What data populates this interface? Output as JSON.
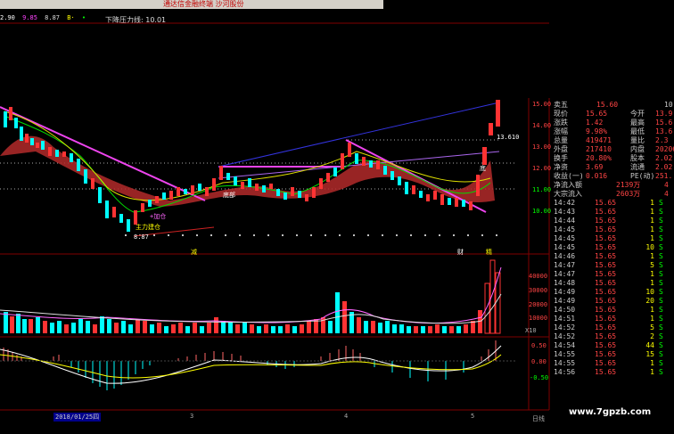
{
  "window": {
    "title": "通达信金融终端 沙河股份"
  },
  "legend": [
    {
      "label": "2.90",
      "color": "#ffffff"
    },
    {
      "label": "9.85",
      "color": "#ff44ff"
    },
    {
      "label": "8.87",
      "color": "#dddddd"
    },
    {
      "label": "B·",
      "color": "#ffff00"
    },
    {
      "label": "•",
      "color": "#00ff00"
    }
  ],
  "chart_title": "下降压力线: 10.01",
  "price_axis": [
    "15.00",
    "14.00",
    "13.00",
    "12.00",
    "11.00",
    "10.00"
  ],
  "price_marker": "13.610",
  "volume_axis": [
    "40000",
    "30000",
    "20000",
    "10000"
  ],
  "volume_unit": "X10",
  "macd_axis": [
    "0.50",
    "0.00",
    "-0.50"
  ],
  "annotations": {
    "a1": "主力建仓",
    "a2": "+加仓",
    "a3": "8.87",
    "a4": "减",
    "a5": "财",
    "a6": "精",
    "a7": "底",
    "a8": "底部"
  },
  "x_axis": {
    "date": "2018/01/25四",
    "ticks": [
      "3",
      "4",
      "5"
    ]
  },
  "corner_label": "日线",
  "watermark": "www.7gpzb.com",
  "quote": {
    "sell5": {
      "label": "卖五",
      "price": "15.60",
      "vol": "10"
    },
    "rows": [
      {
        "l1": "现价",
        "v1": "15.65",
        "l2": "今开",
        "v2": "13.9"
      },
      {
        "l1": "涨跌",
        "v1": "1.42",
        "l2": "最高",
        "v2": "15.6"
      },
      {
        "l1": "涨幅",
        "v1": "9.98%",
        "l2": "最低",
        "v2": "13.6"
      },
      {
        "l1": "总量",
        "v1": "419471",
        "l2": "量比",
        "v2": "2.3"
      },
      {
        "l1": "外盘",
        "v1": "217410",
        "l2": "内盘",
        "v2": "20206"
      },
      {
        "l1": "换手",
        "v1": "20.80%",
        "l2": "股本",
        "v2": "2.02"
      },
      {
        "l1": "净资",
        "v1": "3.69",
        "l2": "流通",
        "v2": "2.02"
      },
      {
        "l1": "收益(一)",
        "v1": "0.016",
        "l2": "PE(动)",
        "v2": "251."
      },
      {
        "l1": "净流入额",
        "v1": "2139万",
        "l2": "",
        "v2": "4"
      },
      {
        "l1": "大宗流入",
        "v1": "2603万",
        "l2": "",
        "v2": "4"
      }
    ],
    "ticks": [
      {
        "t": "14:42",
        "p": "15.65",
        "v": "1",
        "s": "S"
      },
      {
        "t": "14:43",
        "p": "15.65",
        "v": "1",
        "s": "S"
      },
      {
        "t": "14:44",
        "p": "15.65",
        "v": "1",
        "s": "S"
      },
      {
        "t": "14:45",
        "p": "15.65",
        "v": "1",
        "s": "S"
      },
      {
        "t": "14:45",
        "p": "15.65",
        "v": "1",
        "s": "S"
      },
      {
        "t": "14:45",
        "p": "15.65",
        "v": "10",
        "s": "S"
      },
      {
        "t": "14:46",
        "p": "15.65",
        "v": "1",
        "s": "S"
      },
      {
        "t": "14:47",
        "p": "15.65",
        "v": "5",
        "s": "S"
      },
      {
        "t": "14:47",
        "p": "15.65",
        "v": "1",
        "s": "S"
      },
      {
        "t": "14:48",
        "p": "15.65",
        "v": "1",
        "s": "S"
      },
      {
        "t": "14:49",
        "p": "15.65",
        "v": "10",
        "s": "S"
      },
      {
        "t": "14:49",
        "p": "15.65",
        "v": "20",
        "s": "S"
      },
      {
        "t": "14:50",
        "p": "15.65",
        "v": "1",
        "s": "S"
      },
      {
        "t": "14:51",
        "p": "15.65",
        "v": "1",
        "s": "S"
      },
      {
        "t": "14:52",
        "p": "15.65",
        "v": "5",
        "s": "S"
      },
      {
        "t": "14:52",
        "p": "15.65",
        "v": "2",
        "s": "S"
      },
      {
        "t": "14:54",
        "p": "15.65",
        "v": "44",
        "s": "S"
      },
      {
        "t": "14:55",
        "p": "15.65",
        "v": "15",
        "s": "S"
      },
      {
        "t": "14:55",
        "p": "15.65",
        "v": "1",
        "s": "S"
      },
      {
        "t": "14:56",
        "p": "15.65",
        "v": "1",
        "s": "S"
      }
    ]
  }
}
